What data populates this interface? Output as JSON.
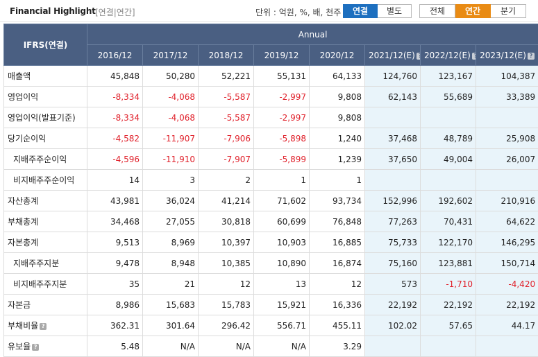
{
  "header": {
    "title": "Financial Highlight",
    "subtitle": "[연결|연간]",
    "unit_text": "단위 : 억원, %, 배, 천주",
    "consolidation_tabs": [
      "연결",
      "별도"
    ],
    "period_tabs": [
      "전체",
      "연간",
      "분기"
    ],
    "active_consolidation": "연결",
    "active_period": "연간"
  },
  "table": {
    "corner_label": "IFRS(연결)",
    "group_label": "Annual",
    "years": [
      "2016/12",
      "2017/12",
      "2018/12",
      "2019/12",
      "2020/12",
      "2021/12(E)",
      "2022/12(E)",
      "2023/12(E)"
    ],
    "estimate_help_mark": "?",
    "rows": [
      {
        "label": "매출액",
        "values": [
          "45,848",
          "50,280",
          "52,221",
          "55,131",
          "64,133",
          "124,760",
          "123,167",
          "104,387"
        ]
      },
      {
        "label": "영업이익",
        "values": [
          "-8,334",
          "-4,068",
          "-5,587",
          "-2,997",
          "9,808",
          "62,143",
          "55,689",
          "33,389"
        ]
      },
      {
        "label": "영업이익(발표기준)",
        "values": [
          "-8,334",
          "-4,068",
          "-5,587",
          "-2,997",
          "9,808",
          "",
          "",
          ""
        ]
      },
      {
        "label": "당기순이익",
        "values": [
          "-4,582",
          "-11,907",
          "-7,906",
          "-5,898",
          "1,240",
          "37,468",
          "48,789",
          "25,908"
        ]
      },
      {
        "label": "지배주주순이익",
        "sub": true,
        "values": [
          "-4,596",
          "-11,910",
          "-7,907",
          "-5,899",
          "1,239",
          "37,650",
          "49,004",
          "26,007"
        ]
      },
      {
        "label": "비지배주주순이익",
        "sub": true,
        "values": [
          "14",
          "3",
          "2",
          "1",
          "1",
          "",
          "",
          ""
        ]
      },
      {
        "label": "자산총계",
        "values": [
          "43,981",
          "36,024",
          "41,214",
          "71,602",
          "93,734",
          "152,996",
          "192,602",
          "210,916"
        ]
      },
      {
        "label": "부채총계",
        "values": [
          "34,468",
          "27,055",
          "30,818",
          "60,699",
          "76,848",
          "77,263",
          "70,431",
          "64,622"
        ]
      },
      {
        "label": "자본총계",
        "values": [
          "9,513",
          "8,969",
          "10,397",
          "10,903",
          "16,885",
          "75,733",
          "122,170",
          "146,295"
        ]
      },
      {
        "label": "지배주주지분",
        "sub": true,
        "values": [
          "9,478",
          "8,948",
          "10,385",
          "10,890",
          "16,874",
          "75,160",
          "123,881",
          "150,714"
        ]
      },
      {
        "label": "비지배주주지분",
        "sub": true,
        "values": [
          "35",
          "21",
          "12",
          "13",
          "12",
          "573",
          "-1,710",
          "-4,420"
        ]
      },
      {
        "label": "자본금",
        "values": [
          "8,986",
          "15,683",
          "15,783",
          "15,921",
          "16,336",
          "22,192",
          "22,192",
          "22,192"
        ]
      },
      {
        "label": "부채비율",
        "help": true,
        "values": [
          "362.31",
          "301.64",
          "296.42",
          "556.71",
          "455.11",
          "102.02",
          "57.65",
          "44.17"
        ]
      },
      {
        "label": "유보율",
        "help": true,
        "values": [
          "5.48",
          "N/A",
          "N/A",
          "N/A",
          "3.29",
          "",
          "",
          ""
        ]
      }
    ]
  },
  "colors": {
    "header_bg": "#4a5f82",
    "estimate_bg": "#e9f4fa",
    "negative": "#e0202a",
    "active_blue": "#1d6fbf",
    "active_orange": "#e98b14"
  }
}
